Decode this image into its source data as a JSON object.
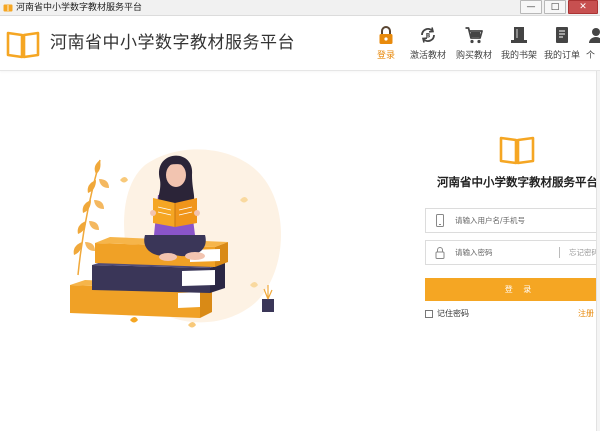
{
  "window": {
    "title": "河南省中小学数字教材服务平台",
    "buttons": {
      "minimize": "—",
      "maximize": "□",
      "close": "✕"
    }
  },
  "header": {
    "app_name": "河南省中小学数字教材服务平台",
    "logo_icon": "open-book-icon",
    "accent_color": "#f5a623",
    "nav": [
      {
        "label": "登录",
        "icon": "lock-icon",
        "active": true
      },
      {
        "label": "激活教材",
        "icon": "activate-refresh-icon",
        "active": false
      },
      {
        "label": "购买教材",
        "icon": "shopping-cart-icon",
        "active": false
      },
      {
        "label": "我的书架",
        "icon": "bookshelf-icon",
        "active": false
      },
      {
        "label": "我的订单",
        "icon": "order-document-icon",
        "active": false
      },
      {
        "label": "个",
        "icon": "user-icon",
        "active": false
      }
    ]
  },
  "login": {
    "logo_icon": "open-book-icon",
    "title": "河南省中小学数字教材服务平台",
    "username": {
      "placeholder": "请输入用户名/手机号",
      "value": "",
      "icon": "phone-icon"
    },
    "password": {
      "placeholder": "请输入密码",
      "value": "",
      "icon": "lock-icon",
      "forgot_label": "忘记密码"
    },
    "submit_label": "登 录",
    "remember_label": "记住密码",
    "remember_checked": false,
    "register_label": "注册"
  },
  "illustration": {
    "subject": "girl-reading-on-books-illustration",
    "colors": [
      "#f5a623",
      "#3a3658",
      "#8a55c9"
    ]
  }
}
